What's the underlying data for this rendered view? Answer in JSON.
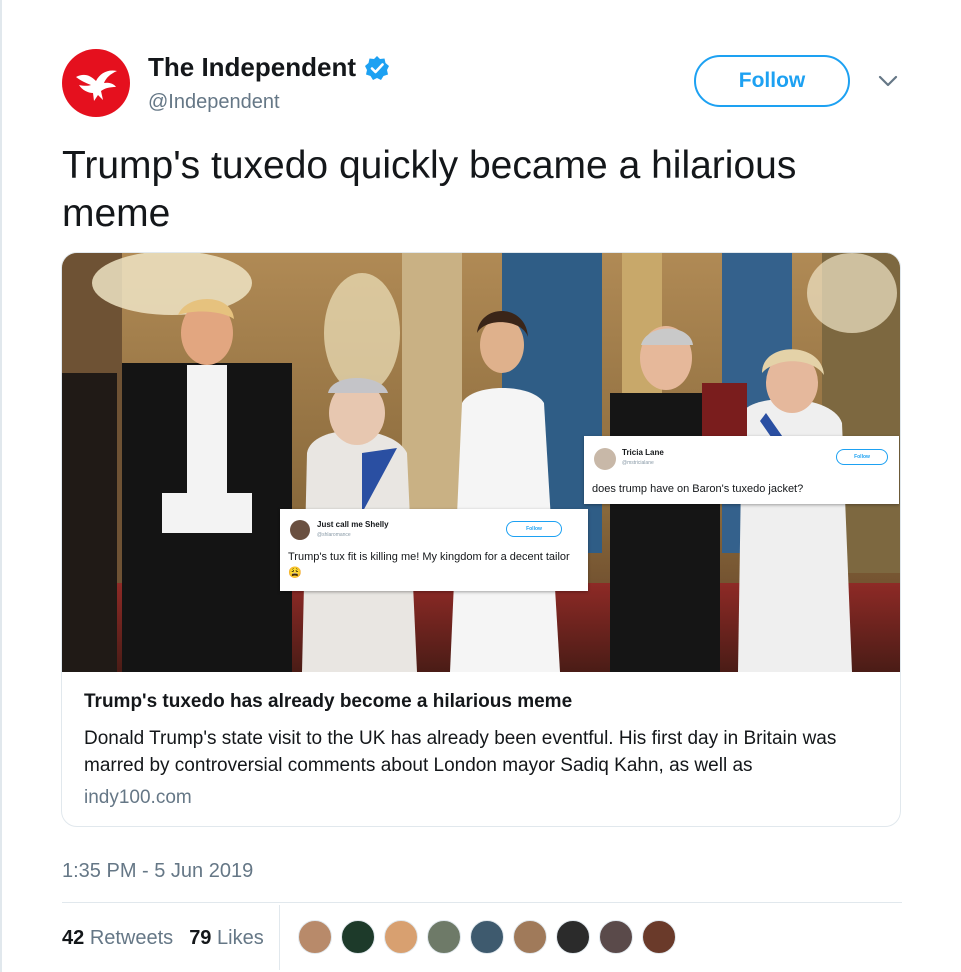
{
  "account": {
    "name": "The Independent",
    "handle": "@Independent",
    "follow_label": "Follow"
  },
  "tweet": {
    "text": "Trump's tuxedo quickly became a hilarious meme",
    "timestamp": "1:35 PM - 5 Jun 2019"
  },
  "card": {
    "title": "Trump's tuxedo has already become a hilarious meme",
    "description": "Donald Trump's state visit to the UK has already been eventful.  His first day in Britain was marred by controversial comments about London mayor Sadiq Kahn, as well as",
    "domain": "indy100.com",
    "embedded_tweets": [
      {
        "name": "Tricia Lane",
        "handle": "@mstricialane",
        "follow_label": "Follow",
        "text": "does trump have on Baron's tuxedo jacket?"
      },
      {
        "name": "Just call me Shelly",
        "handle": "@shlaromance",
        "follow_label": "Follow",
        "text": "Trump's tux fit is killing me! My kingdom for a decent tailor 😩"
      }
    ]
  },
  "stats": {
    "retweets_count": "42",
    "retweets_label": "Retweets",
    "likes_count": "79",
    "likes_label": "Likes"
  },
  "likers": [
    {
      "name": "liker-1",
      "color": "#b88a6a"
    },
    {
      "name": "liker-2",
      "color": "#1d3a2a"
    },
    {
      "name": "liker-3",
      "color": "#d8a070"
    },
    {
      "name": "liker-4",
      "color": "#6e7a68"
    },
    {
      "name": "liker-5",
      "color": "#3e5a6e"
    },
    {
      "name": "liker-6",
      "color": "#a07a5a"
    },
    {
      "name": "liker-7",
      "color": "#2b2b2b"
    },
    {
      "name": "liker-8",
      "color": "#5a4a4a"
    },
    {
      "name": "liker-9",
      "color": "#6a3a2a"
    }
  ],
  "colors": {
    "brand_red": "#e5101e",
    "twitter_blue": "#1da1f2",
    "secondary_text": "#657786",
    "border": "#e1e8ed"
  },
  "icons": {
    "avatar": "eagle-logo-icon",
    "verified": "verified-badge-icon",
    "menu": "chevron-down-icon"
  }
}
